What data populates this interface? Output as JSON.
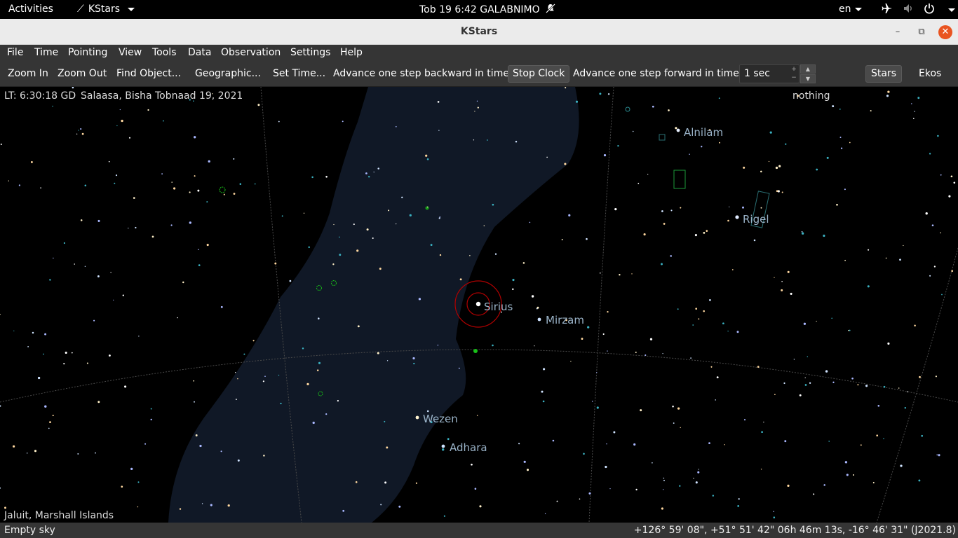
{
  "topbar": {
    "activities": "Activities",
    "app_name": "KStars",
    "clock": "Tob 19  6:42 GALABNIMO",
    "language": "en"
  },
  "window": {
    "title": "KStars"
  },
  "menu": {
    "file": "File",
    "time": "Time",
    "pointing": "Pointing",
    "view": "View",
    "tools": "Tools",
    "data": "Data",
    "observation": "Observation",
    "settings": "Settings",
    "help": "Help"
  },
  "toolbar": {
    "zoom_in": "Zoom In",
    "zoom_out": "Zoom Out",
    "find_object": "Find Object...",
    "geographic": "Geographic...",
    "set_time": "Set Time...",
    "step_back": "Advance one step backward in time",
    "stop_clock": "Stop Clock",
    "step_forward": "Advance one step forward in time",
    "time_step": "1 sec",
    "stars": "Stars",
    "ekos": "Ekos"
  },
  "sky": {
    "local_time": "LT: 6:30:18 GD",
    "date": "Salaasa, Bisha Tobnaad 19, 2021",
    "focus": "nothing",
    "location": "Jaluit, Marshall Islands",
    "labels": {
      "sirius": "Sirius",
      "mirzam": "Mirzam",
      "wezen": "Wezen",
      "adhara": "Adhara",
      "alnilam": "Alnilam",
      "rigel": "Rigel"
    }
  },
  "statusbar": {
    "object": "Empty sky",
    "coordinates": "+126° 59' 08\", +51° 51' 42\"  06h 46m 13s, -16° 46' 31\" (J2021.8)"
  }
}
